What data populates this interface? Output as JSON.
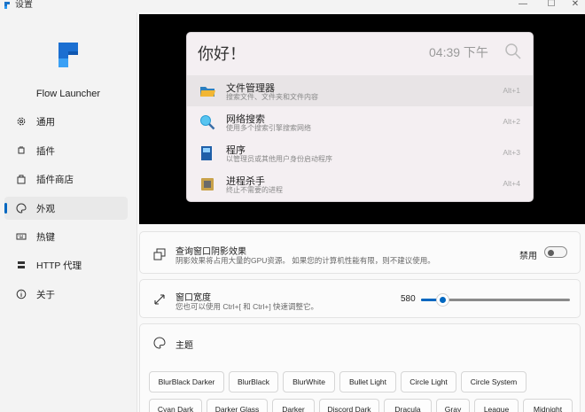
{
  "window": {
    "title": "设置",
    "minimize": "—",
    "maximize": "☐",
    "close": "✕"
  },
  "sidebar": {
    "brand": "Flow Launcher",
    "items": [
      {
        "label": "通用",
        "icon": "gear-icon"
      },
      {
        "label": "插件",
        "icon": "plugin-icon"
      },
      {
        "label": "插件商店",
        "icon": "store-icon"
      },
      {
        "label": "外观",
        "icon": "palette-icon",
        "active": true
      },
      {
        "label": "热键",
        "icon": "keyboard-icon"
      },
      {
        "label": "HTTP 代理",
        "icon": "proxy-icon"
      },
      {
        "label": "关于",
        "icon": "info-icon"
      }
    ]
  },
  "preview": {
    "query": "你好！",
    "clock": "04:39 下午",
    "results": [
      {
        "title": "文件管理器",
        "subtitle": "搜索文件、文件夹和文件内容",
        "hotkey": "Alt+1",
        "icon": "folder-icon"
      },
      {
        "title": "网络搜索",
        "subtitle": "使用多个搜索引擎搜索网络",
        "hotkey": "Alt+2",
        "icon": "magnifier-icon"
      },
      {
        "title": "程序",
        "subtitle": "以管理员或其他用户身份启动程序",
        "hotkey": "Alt+3",
        "icon": "program-icon"
      },
      {
        "title": "进程杀手",
        "subtitle": "终止不需要的进程",
        "hotkey": "Alt+4",
        "icon": "cpu-icon"
      }
    ]
  },
  "shadow_card": {
    "title": "查询窗口阴影效果",
    "desc": "阴影效果将占用大量的GPU资源。 如果您的计算机性能有限，则不建议使用。",
    "toggle_label": "禁用",
    "enabled": false
  },
  "width_card": {
    "title": "窗口宽度",
    "desc": "您也可以使用 Ctrl+[ 和 Ctrl+] 快速调整它。",
    "value": "580",
    "slider_fraction": 0.14
  },
  "theme_card": {
    "title": "主题",
    "themes": [
      "BlurBlack Darker",
      "BlurBlack",
      "BlurWhite",
      "Bullet Light",
      "Circle Light",
      "Circle System",
      "Cyan Dark",
      "Darker Glass",
      "Darker",
      "Discord Dark",
      "Dracula",
      "Gray",
      "League",
      "Midnight"
    ]
  },
  "colors": {
    "accent": "#0067c0",
    "preview_bg": "#000000"
  }
}
